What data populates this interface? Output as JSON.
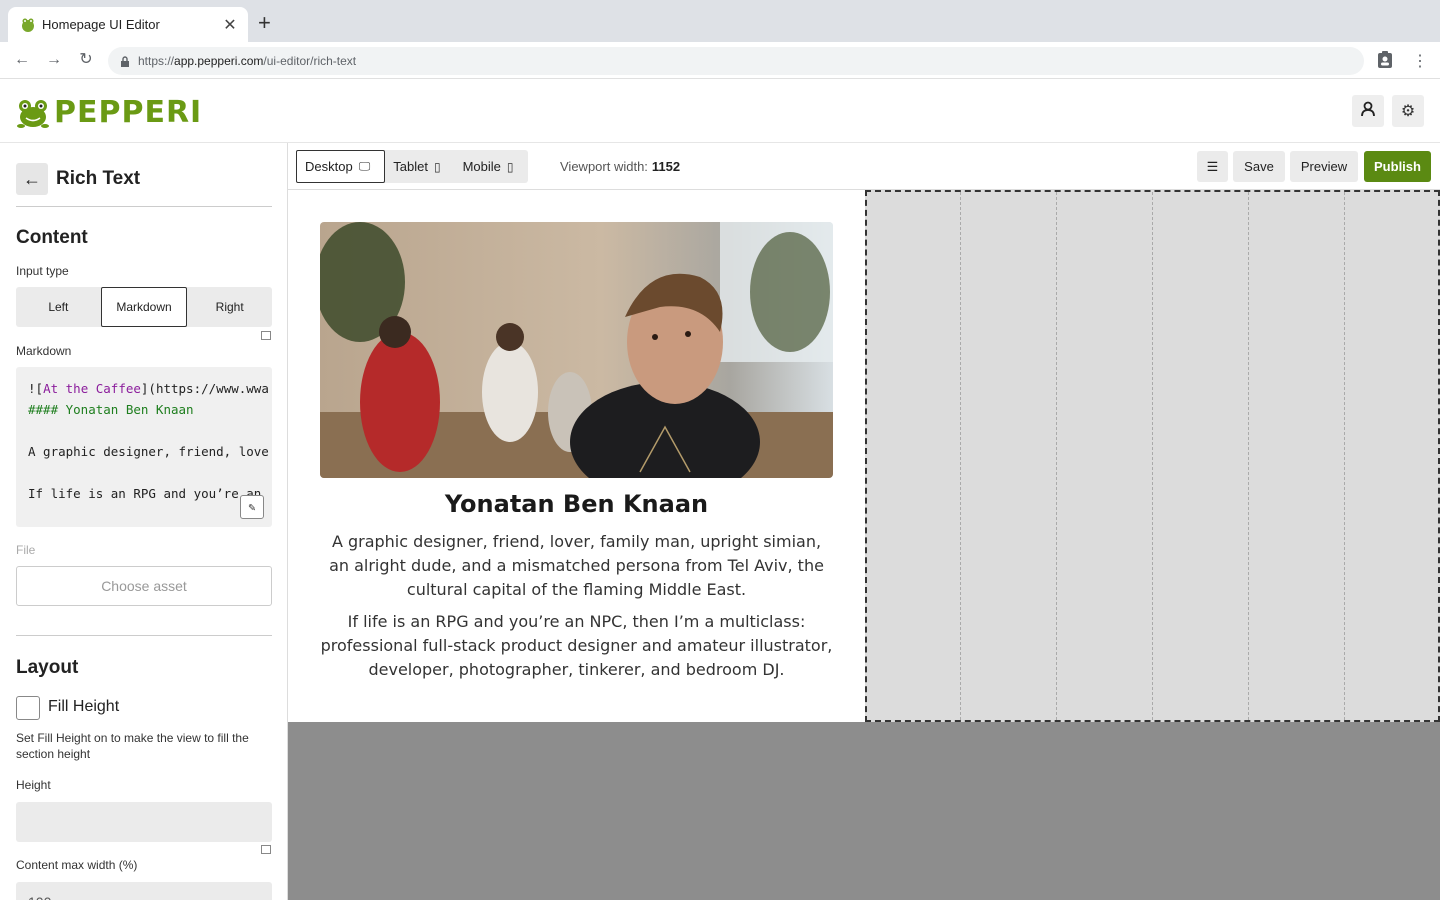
{
  "browser": {
    "tab_title": "Homepage UI Editor",
    "url_scheme": "https://",
    "url_host": "app.pepperi.com",
    "url_path": "/ui-editor/rich-text"
  },
  "app": {
    "brand": "PEPPERI"
  },
  "panel": {
    "title": "Rich Text",
    "content_heading": "Content",
    "input_type_label": "Input type",
    "input_types": [
      "Left",
      "Markdown",
      "Right"
    ],
    "selected_input_type": "Markdown",
    "markdown_label": "Markdown",
    "markdown_lines": [
      {
        "prefix": "![",
        "link": "At the Caffee",
        "suffix": "](https://www.wwa"
      },
      {
        "heading": "#### Yonatan Ben Knaan"
      },
      {
        "text": ""
      },
      {
        "text": "A graphic designer, friend, love"
      },
      {
        "text": ""
      },
      {
        "text": "If life is an RPG and you’re an"
      }
    ],
    "file_label": "File",
    "choose_asset": "Choose asset",
    "layout_heading": "Layout",
    "fill_height_label": "Fill Height",
    "fill_height_checked": false,
    "fill_height_hint": "Set Fill Height on to make the view to fill the section height",
    "height_label": "Height",
    "height_value": "",
    "max_width_label": "Content max width (%)",
    "max_width_value": "100"
  },
  "toolbar": {
    "devices": [
      "Desktop",
      "Tablet",
      "Mobile"
    ],
    "selected_device": "Desktop",
    "viewport_label": "Viewport width:",
    "viewport_value": "1152",
    "save": "Save",
    "preview": "Preview",
    "publish": "Publish"
  },
  "preview": {
    "name": "Yonatan Ben Knaan",
    "para1": "A graphic designer, friend, lover, family man, upright simian, an alright dude, and a mismatched persona from Tel Aviv, the cultural capital of the flaming Middle East.",
    "para2": "If life is an RPG and you’re an NPC, then I’m a multiclass: professional full-stack product designer and amateur illustrator, developer, photographer, tinkerer, and bedroom DJ."
  },
  "colors": {
    "brand_green": "#6a9a14",
    "publish_green": "#5b8a12",
    "markdown_link": "#8b1d9c",
    "markdown_heading": "#1e7e1e"
  }
}
